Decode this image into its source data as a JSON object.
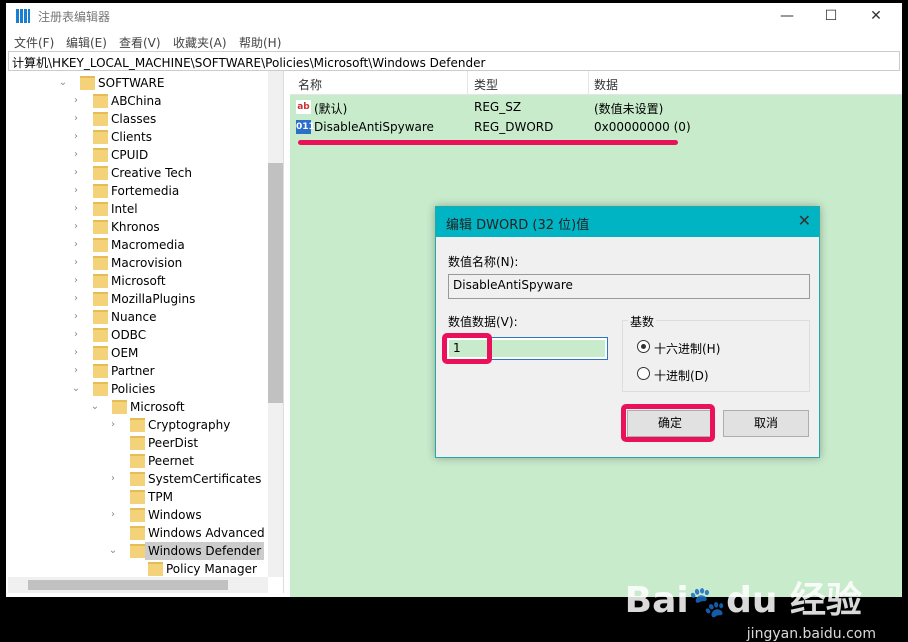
{
  "window": {
    "title": "注册表编辑器",
    "minimize": "—",
    "maximize": "☐",
    "close": "✕"
  },
  "menu": [
    "文件(F)",
    "编辑(E)",
    "查看(V)",
    "收藏夹(A)",
    "帮助(H)"
  ],
  "address": "计算机\\HKEY_LOCAL_MACHINE\\SOFTWARE\\Policies\\Microsoft\\Windows Defender",
  "tree": [
    {
      "label": "SOFTWARE",
      "level": 0,
      "expanded": true
    },
    {
      "label": "ABChina",
      "level": 1
    },
    {
      "label": "Classes",
      "level": 1
    },
    {
      "label": "Clients",
      "level": 1
    },
    {
      "label": "CPUID",
      "level": 1
    },
    {
      "label": "Creative Tech",
      "level": 1
    },
    {
      "label": "Fortemedia",
      "level": 1
    },
    {
      "label": "Intel",
      "level": 1
    },
    {
      "label": "Khronos",
      "level": 1
    },
    {
      "label": "Macromedia",
      "level": 1
    },
    {
      "label": "Macrovision",
      "level": 1
    },
    {
      "label": "Microsoft",
      "level": 1
    },
    {
      "label": "MozillaPlugins",
      "level": 1
    },
    {
      "label": "Nuance",
      "level": 1
    },
    {
      "label": "ODBC",
      "level": 1
    },
    {
      "label": "OEM",
      "level": 1
    },
    {
      "label": "Partner",
      "level": 1
    },
    {
      "label": "Policies",
      "level": 1,
      "expanded": true
    },
    {
      "label": "Microsoft",
      "level": 2,
      "expanded": true
    },
    {
      "label": "Cryptography",
      "level": 3,
      "chevron": true
    },
    {
      "label": "PeerDist",
      "level": 3
    },
    {
      "label": "Peernet",
      "level": 3
    },
    {
      "label": "SystemCertificates",
      "level": 3,
      "chevron": true
    },
    {
      "label": "TPM",
      "level": 3
    },
    {
      "label": "Windows",
      "level": 3,
      "chevron": true
    },
    {
      "label": "Windows Advanced Th",
      "level": 3
    },
    {
      "label": "Windows Defender",
      "level": 3,
      "expanded": true,
      "selected": true
    },
    {
      "label": "Policy Manager",
      "level": 4
    }
  ],
  "list": {
    "columns": [
      "名称",
      "类型",
      "数据"
    ],
    "rows": [
      {
        "icon": "string-value-icon",
        "name": "(默认)",
        "type": "REG_SZ",
        "data": "(数值未设置)"
      },
      {
        "icon": "dword-value-icon",
        "name": "DisableAntiSpyware",
        "type": "REG_DWORD",
        "data": "0x00000000 (0)"
      }
    ]
  },
  "dialog": {
    "title": "编辑 DWORD (32 位)值",
    "name_label": "数值名称(N):",
    "name_value": "DisableAntiSpyware",
    "data_label": "数值数据(V):",
    "data_value": "1",
    "base_label": "基数",
    "hex_label": "十六进制(H)",
    "dec_label": "十进制(D)",
    "selected_base": "hex",
    "ok": "确定",
    "cancel": "取消",
    "close": "✕"
  },
  "watermark": {
    "brand": "Bai du 经验",
    "url": "jingyan.baidu.com"
  },
  "colors": {
    "highlight": "#e8115a",
    "list_bg": "#c8ebcc",
    "dialog_title": "#00b4c4"
  }
}
